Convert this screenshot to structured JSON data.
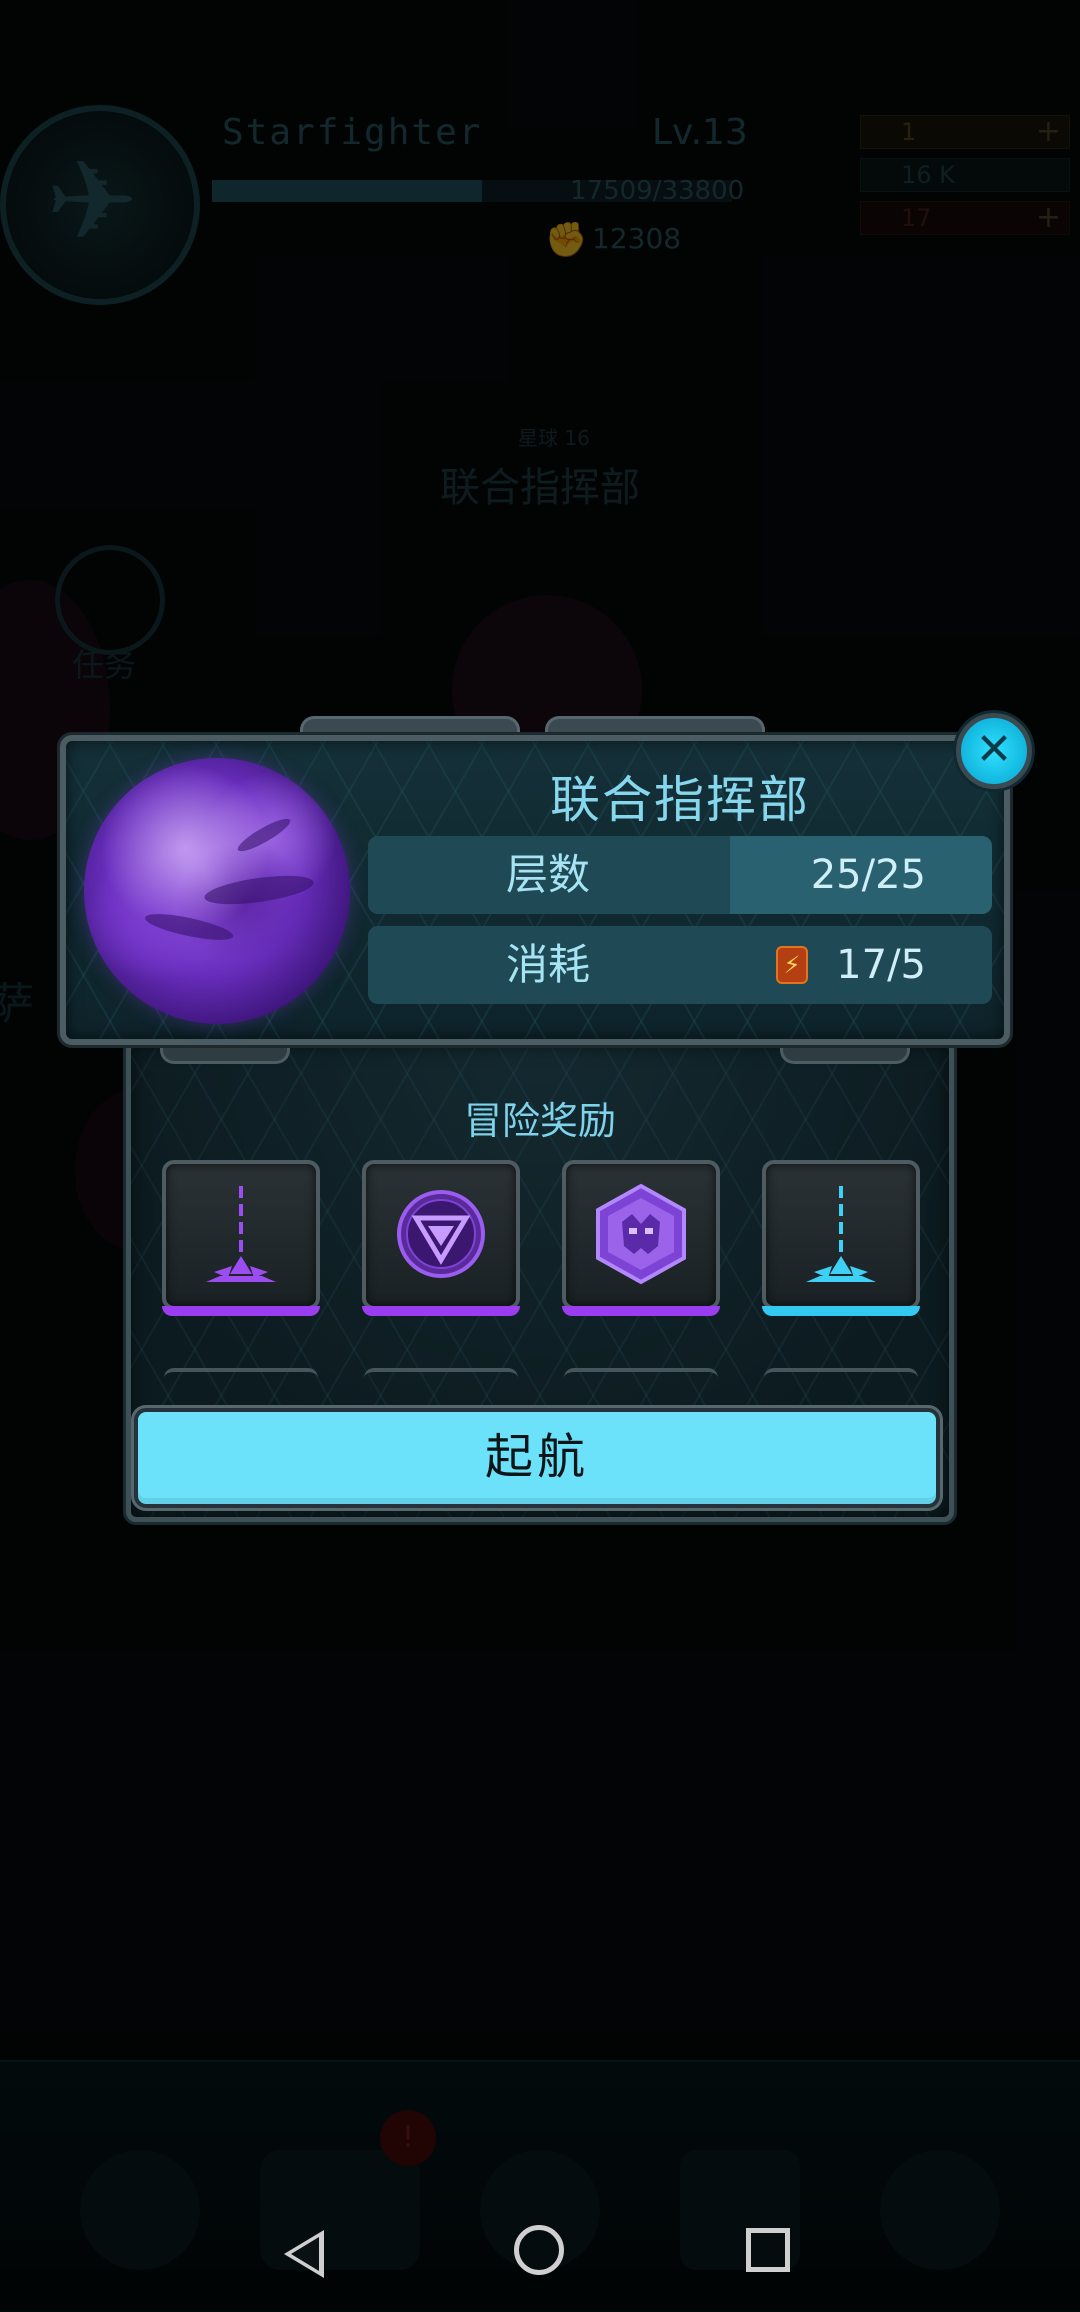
{
  "hud": {
    "player_name": "Starfighter",
    "level": "Lv.13",
    "xp": "17509/33800",
    "xp_fraction": 0.52,
    "power": "12308",
    "resources": [
      "1",
      "16 K",
      "17"
    ]
  },
  "background": {
    "map_node_sub": "星球 16",
    "map_node_title": "联合指挥部",
    "task_label": "任务",
    "side_label": "萨"
  },
  "dialog": {
    "title": "联合指挥部",
    "stats": [
      {
        "label": "层数",
        "value": "25/25",
        "fill_fraction": 0.42
      },
      {
        "label": "消耗",
        "value": "17/5",
        "icon": "energy-icon"
      }
    ],
    "rewards_title": "冒险奖励",
    "rewards": [
      {
        "icon": "purple-missile-icon",
        "rarity_color": "#9a3cf0"
      },
      {
        "icon": "purple-triangle-badge-icon",
        "rarity_color": "#9a3cf0"
      },
      {
        "icon": "purple-hex-mask-icon",
        "rarity_color": "#9a3cf0"
      },
      {
        "icon": "cyan-missile-icon",
        "rarity_color": "#33c8f0"
      }
    ],
    "launch_label": "起航",
    "close_icon": "close-icon"
  },
  "colors": {
    "accent": "#6be2fa",
    "title": "#86d7ee",
    "purple_rarity": "#9a3cf0",
    "cyan_rarity": "#33c8f0"
  }
}
